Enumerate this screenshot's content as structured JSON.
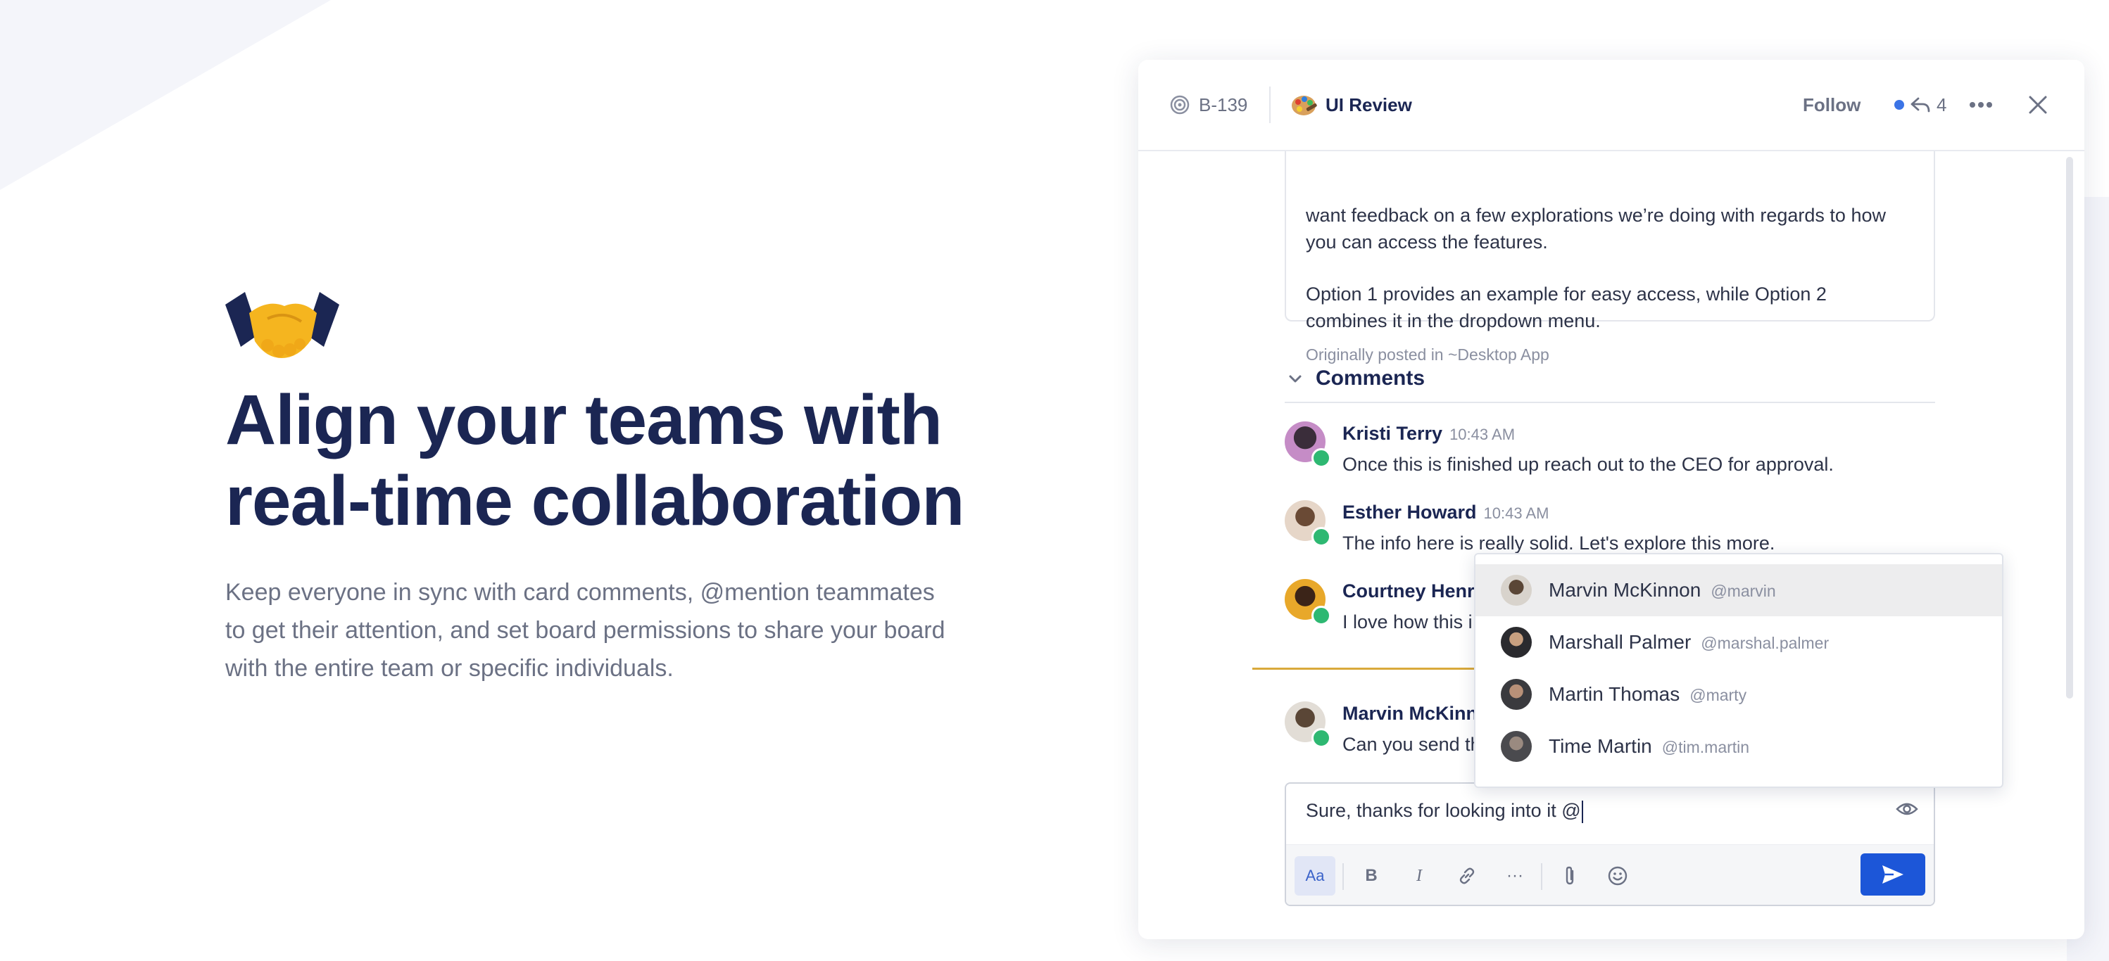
{
  "hero": {
    "headline_line1": "Align your teams with",
    "headline_line2": "real-time collaboration",
    "subtext_line1": "Keep everyone in sync with card comments, @mention teammates",
    "subtext_line2": "to get their attention, and set board permissions to share your board",
    "subtext_line3": "with the entire team or specific individuals.",
    "icon": "handshake-icon"
  },
  "card": {
    "id": "B-139",
    "board": "UI Review",
    "follow_label": "Follow",
    "reply_count": "4",
    "description_line1": "want feedback on a few explorations we’re doing with regards to how",
    "description_line2": "you can access the features.",
    "description_line3": "Option 1 provides an example for easy access, while Option 2",
    "description_line4": "combines it in the dropdown menu.",
    "origin": "Originally posted in ~Desktop App"
  },
  "comments": {
    "title": "Comments",
    "items": [
      {
        "name": "Kristi Terry",
        "time": "10:43 AM",
        "text": "Once this is finished up reach out to the CEO for approval."
      },
      {
        "name": "Esther Howard",
        "time": "10:43 AM",
        "text": "The info here is really solid. Let's explore this more."
      },
      {
        "name": "Courtney Henr",
        "time": "",
        "text": "I love how this i"
      },
      {
        "name": "Marvin McKinn",
        "time": "",
        "text": "Can you send th"
      }
    ]
  },
  "composer": {
    "value": "Sure, thanks for looking into it @",
    "format_label": "Aa",
    "bold_label": "B",
    "italic_label": "I",
    "more_label": "···"
  },
  "mentions": [
    {
      "name": "Marvin McKinnon",
      "handle": "@marvin",
      "selected": true
    },
    {
      "name": "Marshall Palmer",
      "handle": "@marshal.palmer",
      "selected": false
    },
    {
      "name": "Martin Thomas",
      "handle": "@marty",
      "selected": false
    },
    {
      "name": "Time Martin",
      "handle": "@tim.martin",
      "selected": false
    }
  ],
  "colors": {
    "navy": "#1b2653",
    "accent_blue": "#1c56d8",
    "online_green": "#2eb872",
    "new_divider": "#d9a93b"
  }
}
